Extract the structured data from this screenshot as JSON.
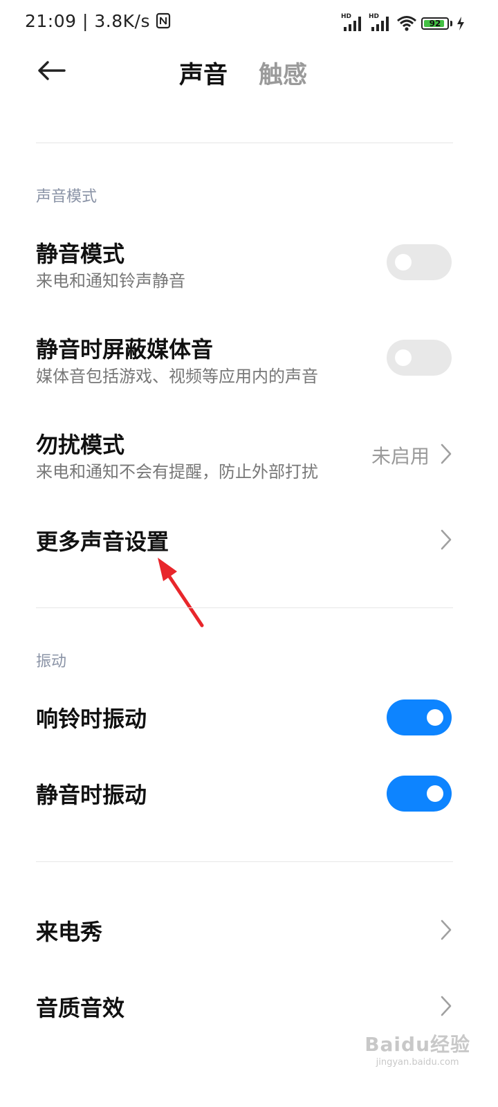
{
  "status_bar": {
    "time": "21:09",
    "speed": "3.8K/s",
    "network_badge_1": "HD",
    "network_badge_2": "HD",
    "battery": "92",
    "icons": [
      "nfc-icon",
      "signal-icon",
      "signal-icon",
      "wifi-icon",
      "battery-icon",
      "charging-icon"
    ]
  },
  "header": {
    "back_icon": "back-arrow-icon",
    "tab_active": "声音",
    "tab_inactive": "触感"
  },
  "sections": {
    "sound_mode": {
      "title": "声音模式",
      "items": [
        {
          "title": "静音模式",
          "subtitle": "来电和通知铃声静音",
          "control": "switch",
          "on": false
        },
        {
          "title": "静音时屏蔽媒体音",
          "subtitle": "媒体音包括游戏、视频等应用内的声音",
          "control": "switch",
          "on": false
        },
        {
          "title": "勿扰模式",
          "subtitle": "来电和通知不会有提醒，防止外部打扰",
          "value": "未启用",
          "control": "chevron"
        },
        {
          "title": "更多声音设置",
          "control": "chevron"
        }
      ]
    },
    "vibration": {
      "title": "振动",
      "items": [
        {
          "title": "响铃时振动",
          "control": "switch",
          "on": true
        },
        {
          "title": "静音时振动",
          "control": "switch",
          "on": true
        }
      ]
    },
    "other": {
      "items": [
        {
          "title": "来电秀",
          "control": "chevron"
        },
        {
          "title": "音质音效",
          "control": "chevron"
        }
      ]
    }
  },
  "colors": {
    "accent": "#0d84ff",
    "switch_off": "#e8e8e8",
    "section_title": "#8a93a6",
    "annotation_arrow": "#e8262b",
    "battery_fill": "#43c043"
  },
  "watermark": {
    "main": "Baidu经验",
    "sub": "jingyan.baidu.com"
  }
}
